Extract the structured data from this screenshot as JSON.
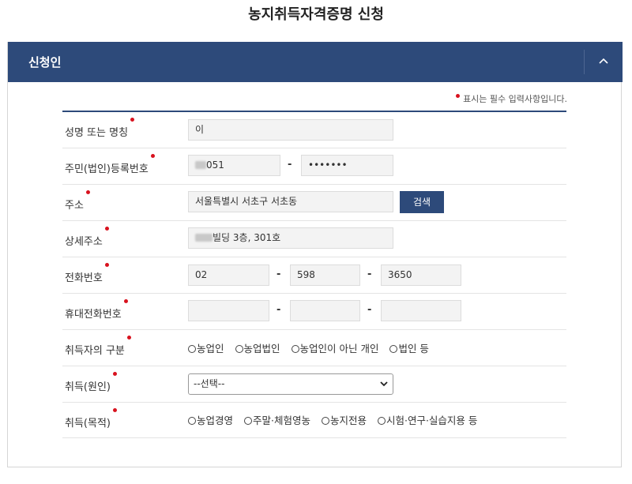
{
  "page": {
    "title": "농지취득자격증명 신청"
  },
  "panel": {
    "title": "신청인",
    "collapse_icon": "chevron-up-icon"
  },
  "required_note": "표시는 필수 입력사항입니다.",
  "form": {
    "name": {
      "label": "성명 또는 명칭",
      "value": "이"
    },
    "reg_no": {
      "label": "주민(법인)등록번호",
      "part1": "051",
      "part2": "•••••••"
    },
    "address": {
      "label": "주소",
      "value": "서울특별시 서초구 서초동",
      "search_label": "검색"
    },
    "detail_address": {
      "label": "상세주소",
      "value": "빌딩 3층, 301호"
    },
    "phone": {
      "label": "전화번호",
      "p1": "02",
      "p2": "598",
      "p3": "3650"
    },
    "mobile": {
      "label": "휴대전화번호",
      "p1": "",
      "p2": "",
      "p3": ""
    },
    "acquirer_type": {
      "label": "취득자의 구분",
      "options": [
        "농업인",
        "농업법인",
        "농업인이 아닌 개인",
        "법인 등"
      ]
    },
    "cause": {
      "label": "취득(원인)",
      "selected": "--선택--"
    },
    "purpose": {
      "label": "취득(목적)",
      "options": [
        "농업경영",
        "주말·체험영농",
        "농지전용",
        "시험·연구·실습지용 등"
      ]
    }
  },
  "dash": "-",
  "colors": {
    "header": "#2d4a7a",
    "required": "#d8121e"
  }
}
